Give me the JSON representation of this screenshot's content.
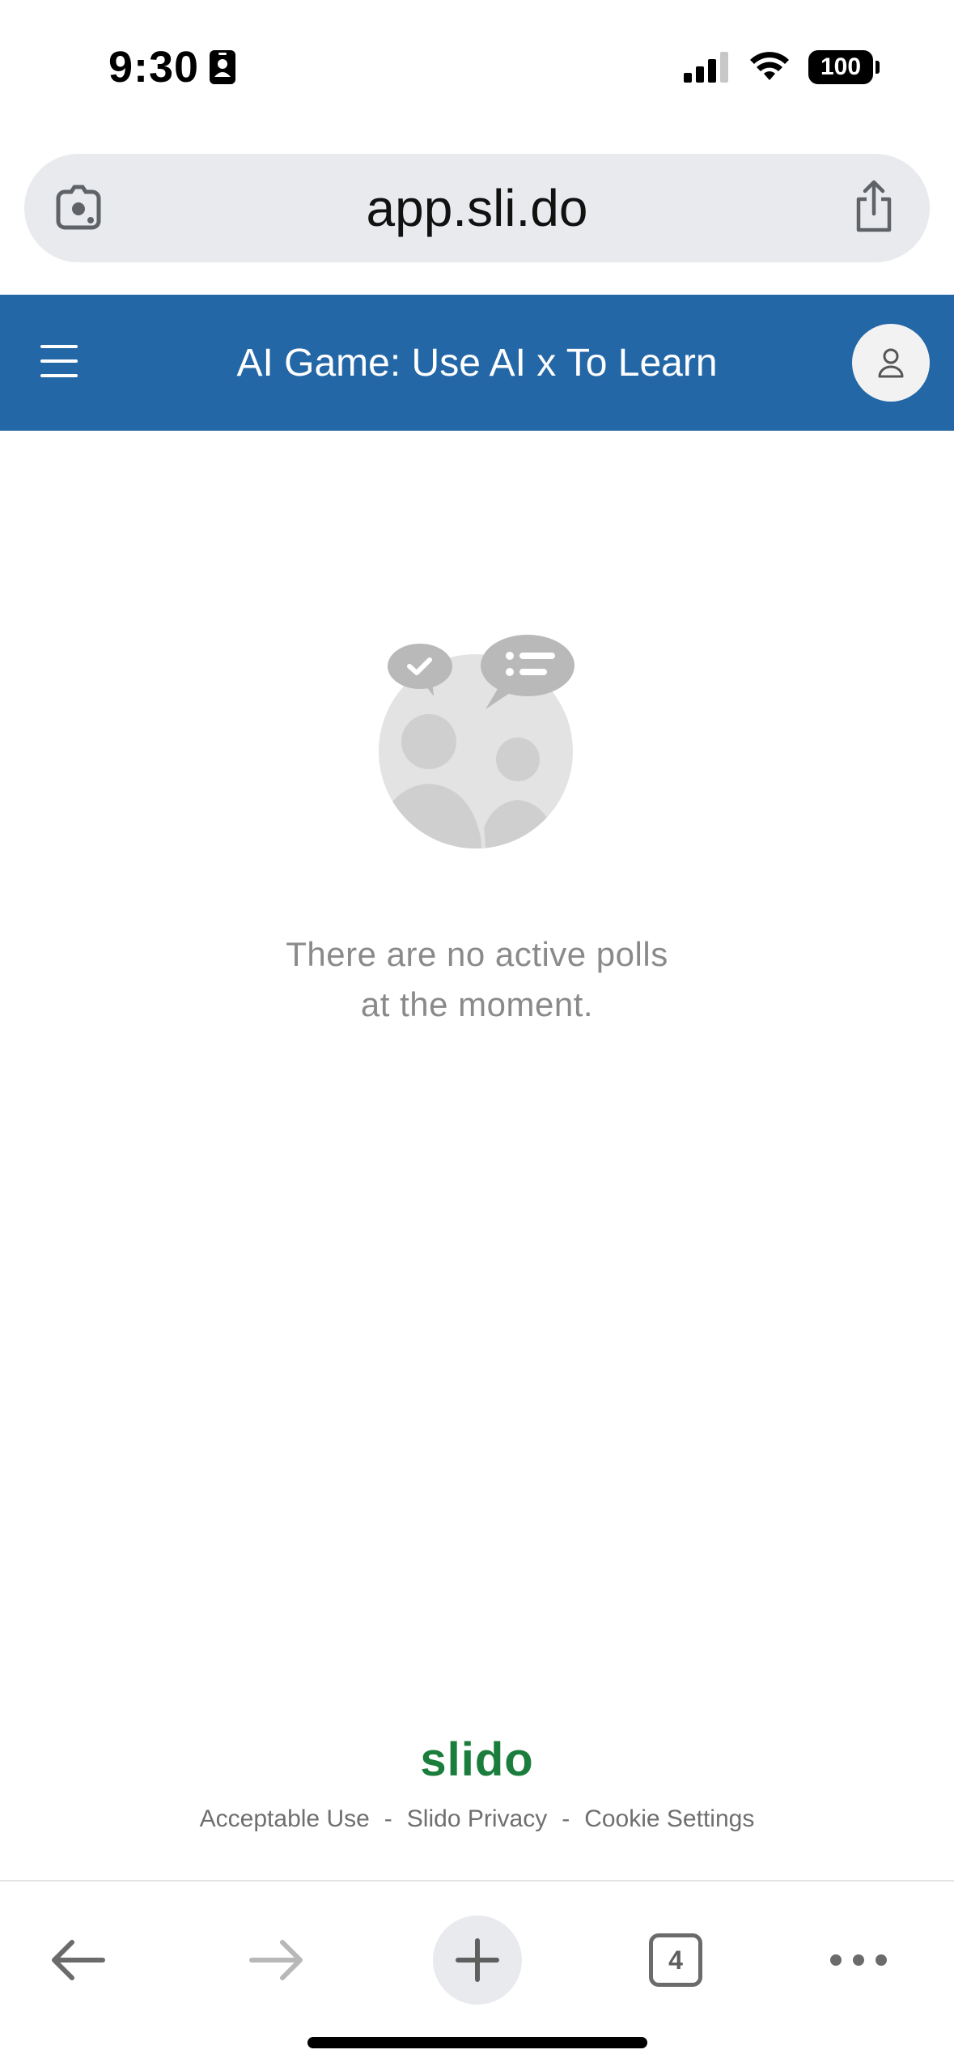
{
  "status_bar": {
    "time": "9:30",
    "battery": "100"
  },
  "url_bar": {
    "url": "app.sli.do"
  },
  "header": {
    "title": "AI Game: Use AI x To Learn"
  },
  "main": {
    "empty_line1": "There are no active polls",
    "empty_line2": "at the moment."
  },
  "footer": {
    "logo": "slido",
    "links": [
      "Acceptable Use",
      "Slido Privacy",
      "Cookie Settings"
    ],
    "separator": "-"
  },
  "toolbar": {
    "tab_count": "4"
  },
  "colors": {
    "header_bg": "#2467a6",
    "brand_green": "#1a7d3c"
  }
}
